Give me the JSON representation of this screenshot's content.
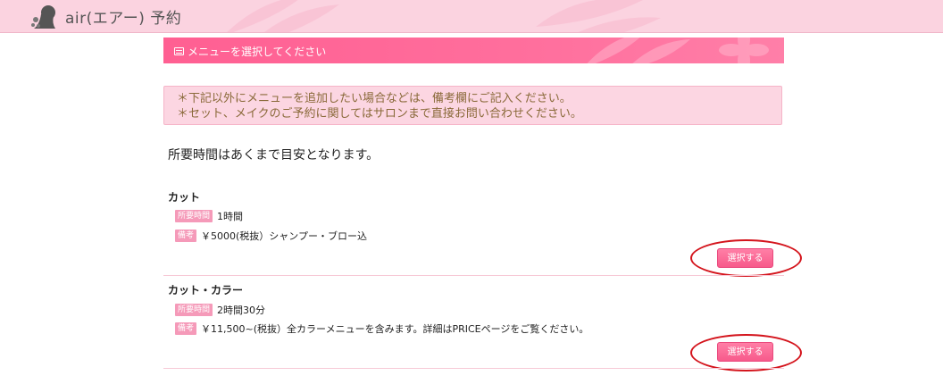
{
  "header": {
    "brand": "air(エアー) 予約"
  },
  "section": {
    "title": "メニューを選択してください"
  },
  "notice": {
    "lines": [
      "＊下記以外にメニューを追加したい場合などは、備考欄にご記入ください。",
      "＊セット、メイクのご予約に関してはサロンまで直接お問い合わせください。"
    ]
  },
  "lead": "所要時間はあくまで目安となります。",
  "menus": [
    {
      "name": "カット",
      "duration_tag": "所要時間",
      "duration": "1時間",
      "note_tag": "備考",
      "note": "￥5000(税抜）シャンプー・ブロー込",
      "button": "選択する"
    },
    {
      "name": "カット・カラー",
      "duration_tag": "所要時間",
      "duration": "2時間30分",
      "note_tag": "備考",
      "note": "￥11,500~(税抜）全カラーメニューを含みます。詳細はPRICEページをご覧ください。",
      "button": "選択する"
    }
  ],
  "colors": {
    "header_bg": "#fbd3e0",
    "accent": "#ff6f9d",
    "tag_bg": "#f59ab9",
    "notice_bg": "#fcd6e2",
    "notice_text": "#8a6a3a",
    "annotation_circle": "#d4141c"
  },
  "icons": {
    "logo": "woman-silhouette-logo",
    "section": "list-icon"
  }
}
